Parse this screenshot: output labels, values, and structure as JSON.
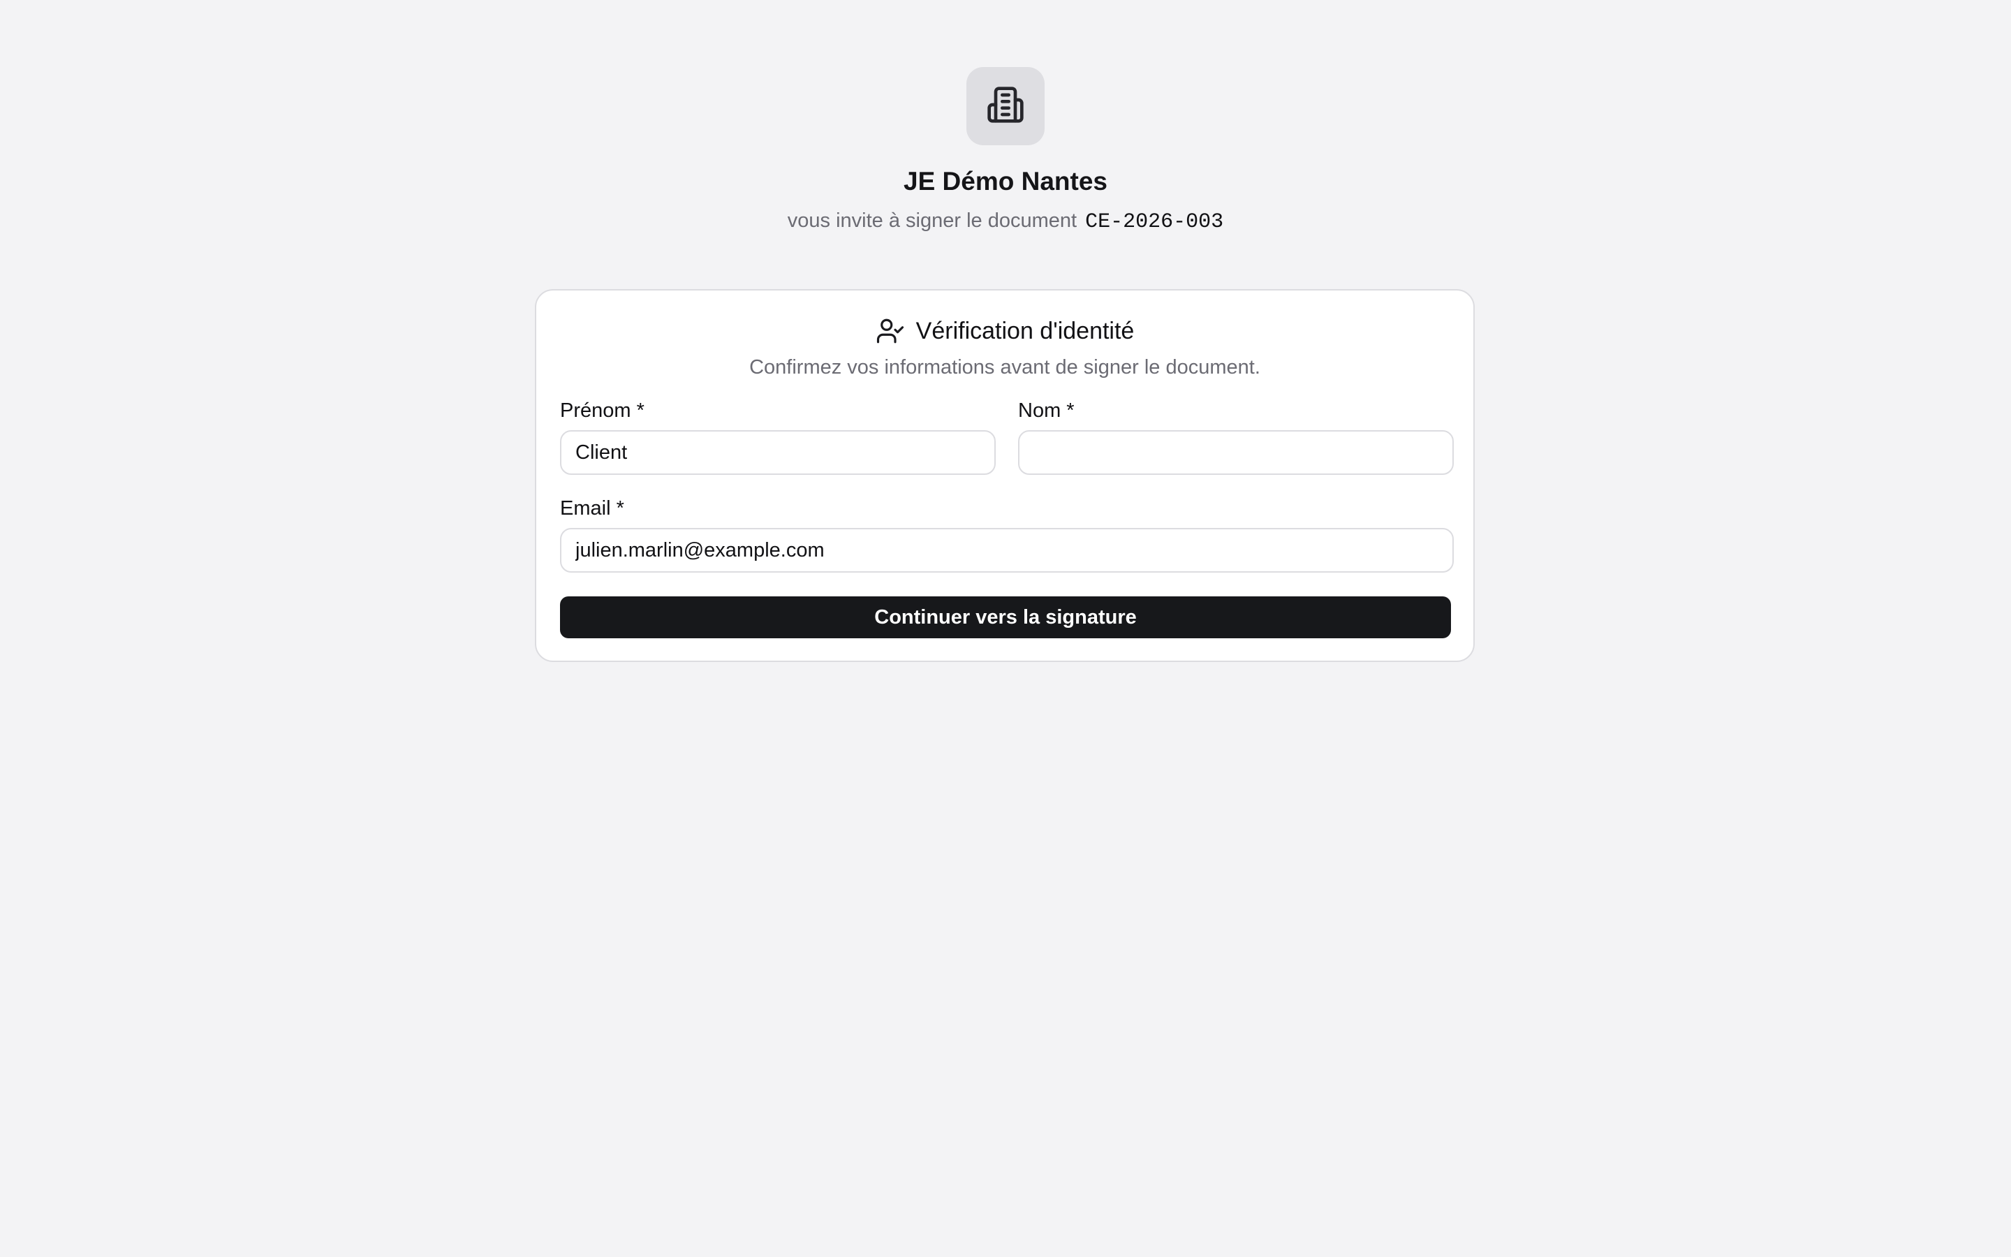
{
  "organization": {
    "name": "JE Démo Nantes",
    "logo_icon": "building-icon"
  },
  "invite": {
    "text": "vous invite à signer le document",
    "document_ref": "CE-2026-003"
  },
  "verification": {
    "title": "Vérification d'identité",
    "title_icon": "user-check-icon",
    "subtitle": "Confirmez vos informations avant de signer le document."
  },
  "form": {
    "first_name": {
      "label": "Prénom *",
      "value": "Client",
      "placeholder": ""
    },
    "last_name": {
      "label": "Nom *",
      "value": "",
      "placeholder": ""
    },
    "email": {
      "label": "Email *",
      "value": "julien.marlin@example.com",
      "placeholder": ""
    },
    "submit_label": "Continuer vers la signature"
  },
  "colors": {
    "background": "#f3f3f5",
    "card": "#ffffff",
    "button": "#17181b",
    "muted_text": "#6b6b73"
  }
}
